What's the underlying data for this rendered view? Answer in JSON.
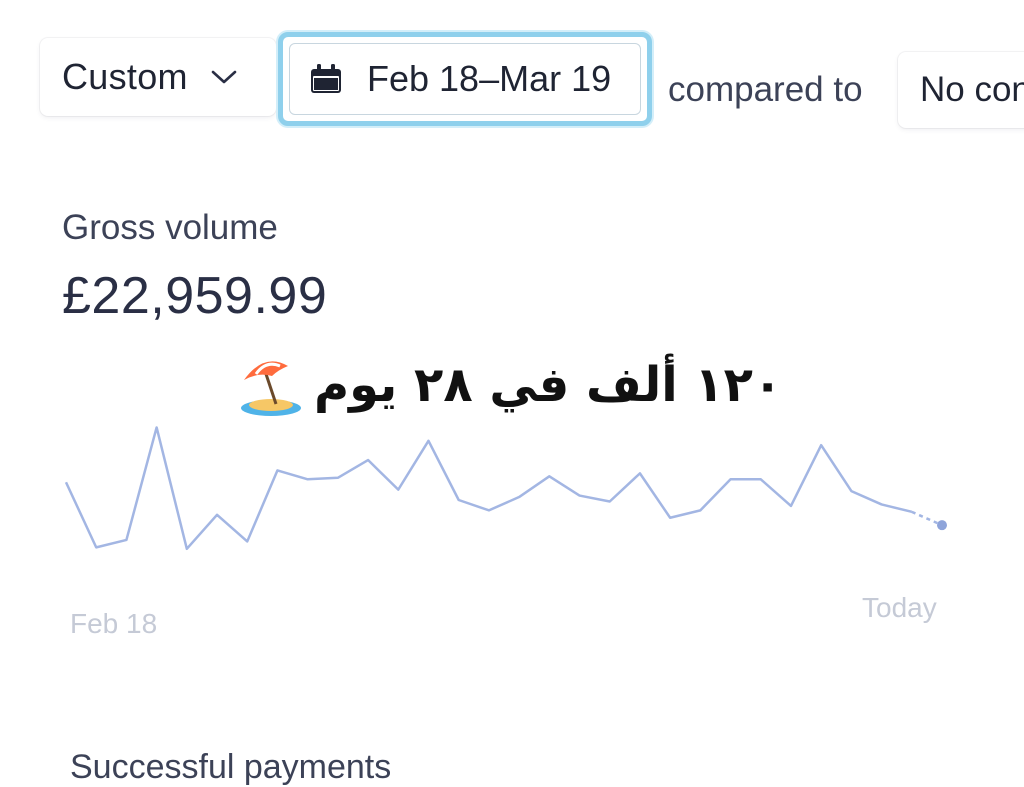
{
  "toolbar": {
    "range_label": "Custom",
    "date_range": "Feb 18–Mar 19",
    "compared_text": "compared to",
    "compare_value": "No con"
  },
  "metric": {
    "label": "Gross volume",
    "value": "£22,959.99"
  },
  "overlay": {
    "caption": "١٢٠ ألف في ٢٨ يوم",
    "emoji": "beach-umbrella-icon"
  },
  "chart_data": {
    "type": "line",
    "x_labels": [
      "Feb 18",
      "Today"
    ],
    "values": [
      620,
      180,
      230,
      990,
      170,
      400,
      220,
      700,
      640,
      650,
      770,
      570,
      900,
      500,
      430,
      520,
      660,
      530,
      490,
      680,
      380,
      430,
      640,
      640,
      460,
      870,
      560,
      470,
      420,
      330
    ],
    "ylim": [
      0,
      1000
    ],
    "grid": false,
    "color": "#a3b6e3",
    "point_color": "#8ea4da"
  },
  "next_section": {
    "title": "Successful payments"
  }
}
